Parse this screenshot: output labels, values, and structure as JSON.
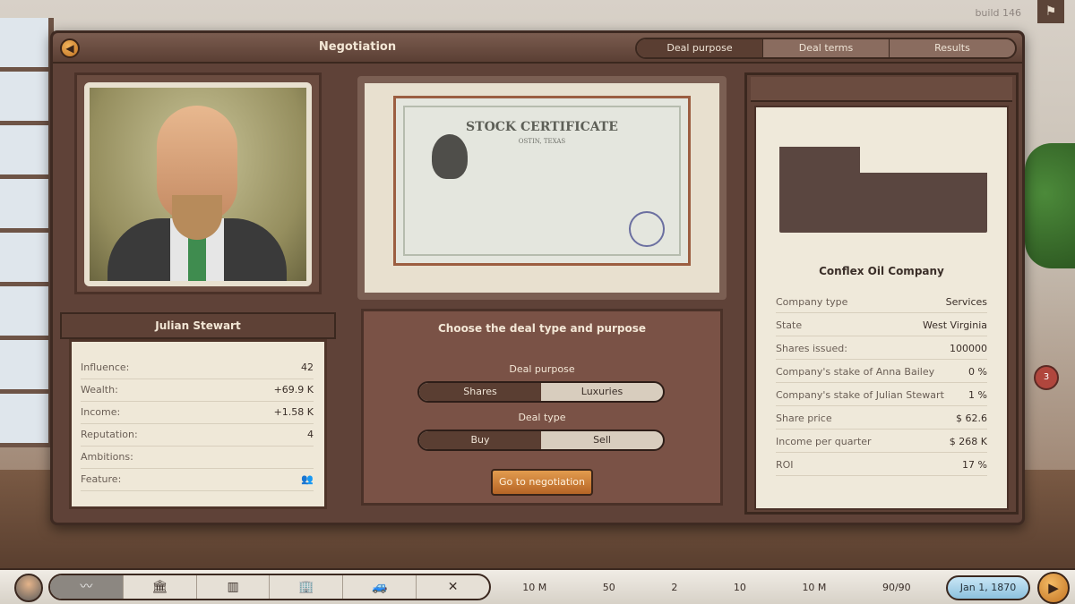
{
  "build": "build 146",
  "window": {
    "title": "Negotiation",
    "tabs": [
      {
        "label": "Deal purpose",
        "active": true
      },
      {
        "label": "Deal terms",
        "active": false
      },
      {
        "label": "Results",
        "active": false
      }
    ]
  },
  "person": {
    "name": "Julian Stewart",
    "stats": [
      {
        "label": "Influence:",
        "value": "42"
      },
      {
        "label": "Wealth:",
        "value": "+69.9 K"
      },
      {
        "label": "Income:",
        "value": "+1.58 K"
      },
      {
        "label": "Reputation:",
        "value": "4"
      },
      {
        "label": "Ambitions:",
        "value": ""
      },
      {
        "label": "Feature:",
        "value": ""
      }
    ]
  },
  "certificate": {
    "title": "STOCK CERTIFICATE",
    "subtitle": "OSTIN, TEXAS"
  },
  "deal": {
    "title": "Choose the deal type and purpose",
    "purpose_label": "Deal purpose",
    "purpose_options": [
      {
        "label": "Shares",
        "active": true
      },
      {
        "label": "Luxuries",
        "active": false
      }
    ],
    "type_label": "Deal type",
    "type_options": [
      {
        "label": "Buy",
        "active": true
      },
      {
        "label": "Sell",
        "active": false
      }
    ],
    "go_label": "Go to negotiation"
  },
  "company": {
    "name": "Conflex Oil Company",
    "rows": [
      {
        "label": "Company type",
        "value": "Services"
      },
      {
        "label": "State",
        "value": "West Virginia"
      },
      {
        "label": "Shares issued:",
        "value": "100000"
      },
      {
        "label": "Company's stake of Anna Bailey",
        "value": "0 %"
      },
      {
        "label": "Company's stake of Julian Stewart",
        "value": "1 %"
      },
      {
        "label": "Share price",
        "value": "$ 62.6"
      },
      {
        "label": "Income per quarter",
        "value": "$ 268 K"
      },
      {
        "label": "ROI",
        "value": "17 %"
      }
    ]
  },
  "side_badge": "3",
  "bottom": {
    "stats": [
      {
        "value": "10 M"
      },
      {
        "value": "50"
      },
      {
        "value": "2"
      },
      {
        "value": "10"
      },
      {
        "value": "10 M"
      },
      {
        "value": "90/90"
      }
    ],
    "date": "Jan 1, 1870"
  }
}
